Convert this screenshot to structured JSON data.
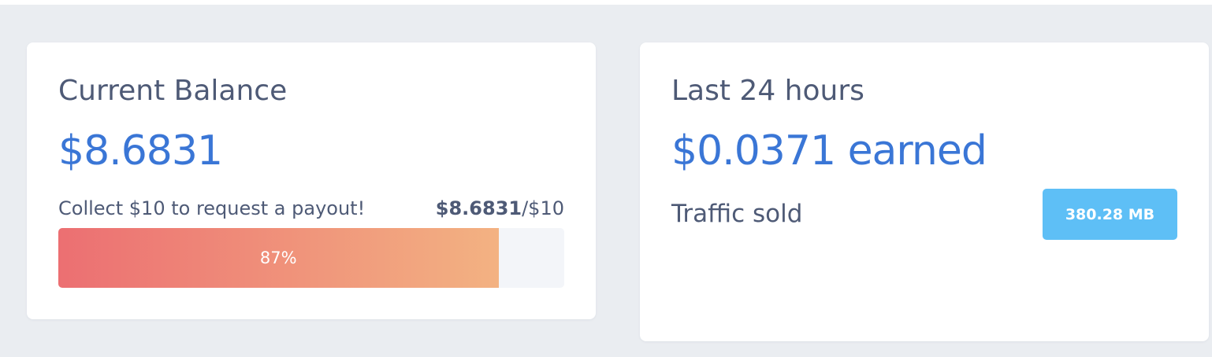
{
  "balance_card": {
    "title": "Current Balance",
    "amount": "$8.6831",
    "payout_message": "Collect $10 to request a payout!",
    "progress_current": "$8.6831",
    "progress_target": "/$10",
    "progress_percent": 87,
    "progress_label": "87%",
    "progress_gradient_start": "#ec6f72",
    "progress_gradient_end": "#f3b282"
  },
  "last24_card": {
    "title": "Last 24 hours",
    "earned": "$0.0371 earned",
    "traffic_label": "Traffic sold",
    "traffic_value": "380.28 MB",
    "badge_color": "#5ebff6"
  },
  "colors": {
    "page_background": "#eaedf1",
    "heading_text": "#4e5a76",
    "accent_value": "#3a76d6"
  }
}
